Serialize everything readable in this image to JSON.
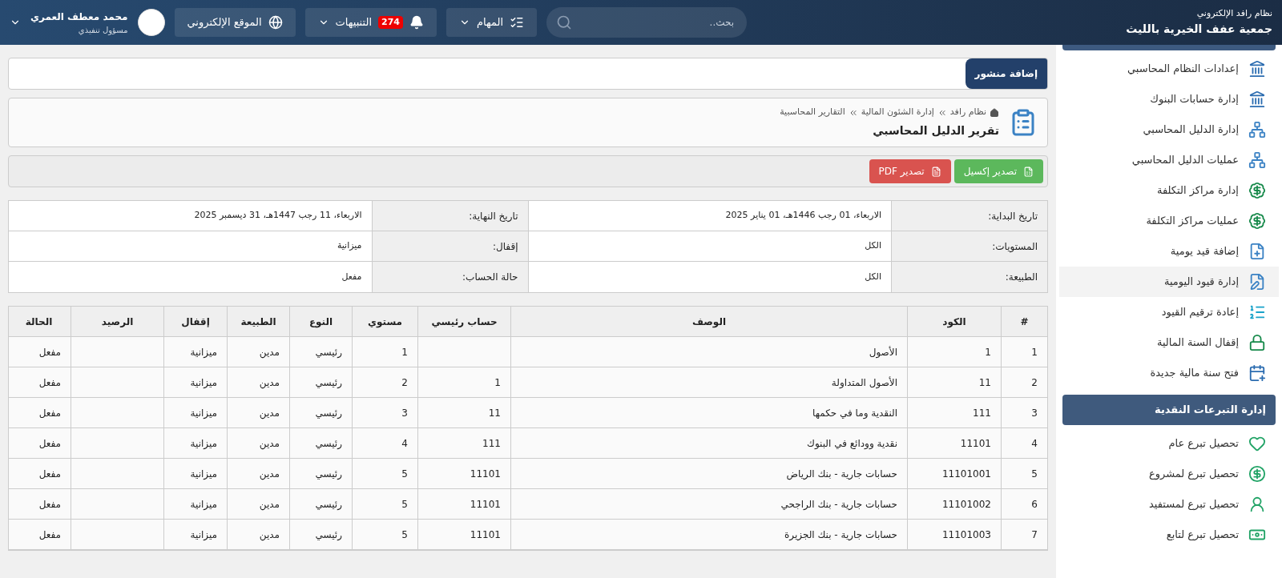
{
  "header": {
    "system": "نظام رافد الإلكتروني",
    "org": "جمعية عفف الخيرية بالليث",
    "search": {
      "placeholder": "بحث.."
    },
    "tasks": "المهام",
    "alerts": {
      "label": "التنبيهات",
      "count": "274"
    },
    "website": "الموقع الإلكتروني",
    "user": {
      "name": "محمد معطف العمري",
      "role": "مسؤول تنفيذي"
    }
  },
  "sidebar": {
    "items": [
      {
        "label": "إعدادات النظام المحاسبي",
        "selected": false
      },
      {
        "label": "إدارة حسابات البنوك",
        "selected": false
      },
      {
        "label": "إدارة الدليل المحاسبي",
        "selected": false
      },
      {
        "label": "عمليات الدليل المحاسبي",
        "selected": false
      },
      {
        "label": "إدارة مراكز التكلفة",
        "selected": false
      },
      {
        "label": "عمليات مراكز التكلفة",
        "selected": false
      },
      {
        "label": "إضافة قيد يومية",
        "selected": false
      },
      {
        "label": "إدارة قيود اليومية",
        "selected": true
      },
      {
        "label": "إعادة ترقيم القيود",
        "selected": false
      },
      {
        "label": "إقفال السنة المالية",
        "selected": false
      },
      {
        "label": "فتح سنة مالية جديدة",
        "selected": false
      }
    ],
    "section": "إدارة التبرعات النقدية",
    "section_items": [
      {
        "label": "تحصيل تبرع عام",
        "selected": false
      },
      {
        "label": "تحصيل تبرع لمشروع",
        "selected": false
      },
      {
        "label": "تحصيل تبرع لمستفيد",
        "selected": false
      },
      {
        "label": "تحصيل تبرع لتابع",
        "selected": false
      }
    ]
  },
  "post_bar": {
    "button": "إضافة منشور"
  },
  "page": {
    "breadcrumb": [
      "نظام رافد",
      "إدارة الشئون المالية",
      "التقارير المحاسبية"
    ],
    "title": "تقرير الدليل المحاسبي"
  },
  "exports": [
    {
      "label": "تصدير إكسيل",
      "kind": "excel"
    },
    {
      "label": "تصدير PDF",
      "kind": "pdf"
    }
  ],
  "filters": [
    [
      {
        "label": "تاريخ البداية:",
        "value": "الاربعاء، 01 رجب 1446هـ، 01 يناير 2025"
      },
      {
        "label": "تاريخ النهاية:",
        "value": "الاربعاء، 11 رجب 1447هـ، 31 ديسمبر 2025"
      }
    ],
    [
      {
        "label": "المستويات:",
        "value": "الكل"
      },
      {
        "label": "إقفال:",
        "value": "ميزانية"
      }
    ],
    [
      {
        "label": "الطبيعة:",
        "value": "الكل"
      },
      {
        "label": "حالة الحساب:",
        "value": "مفعل"
      }
    ]
  ],
  "table": {
    "columns": [
      "#",
      "الكود",
      "الوصف",
      "حساب رئيسي",
      "مستوي",
      "النوع",
      "الطبيعة",
      "إقفال",
      "الرصيد",
      "الحالة"
    ],
    "rows": [
      {
        "n": "1",
        "code": "1",
        "description": "الأصول",
        "level": "1",
        "type": "رئيسي",
        "nature": "مدين",
        "closing": "ميزانية",
        "status": "مفعل"
      },
      {
        "n": "2",
        "code": "11",
        "description": "الأصول المتداولة",
        "parent": "1",
        "level": "2",
        "type": "رئيسي",
        "nature": "مدين",
        "closing": "ميزانية",
        "status": "مفعل"
      },
      {
        "n": "3",
        "code": "111",
        "description": "النقدية وما في حكمها",
        "parent": "11",
        "level": "3",
        "type": "رئيسي",
        "nature": "مدين",
        "closing": "ميزانية",
        "status": "مفعل"
      },
      {
        "n": "4",
        "code": "11101",
        "description": "نقدية وودائع في البنوك",
        "parent": "111",
        "level": "4",
        "type": "رئيسي",
        "nature": "مدين",
        "closing": "ميزانية",
        "status": "مفعل"
      },
      {
        "n": "5",
        "code": "11101001",
        "description": "حسابات جارية - بنك الرياض",
        "parent": "11101",
        "level": "5",
        "type": "رئيسي",
        "nature": "مدين",
        "closing": "ميزانية",
        "status": "مفعل"
      },
      {
        "n": "6",
        "code": "11101002",
        "description": "حسابات جارية - بنك الراجحي",
        "parent": "11101",
        "level": "5",
        "type": "رئيسي",
        "nature": "مدين",
        "closing": "ميزانية",
        "status": "مفعل"
      },
      {
        "n": "7",
        "code": "11101003",
        "description": "حسابات جارية - بنك الجزيرة",
        "parent": "11101",
        "level": "5",
        "type": "رئيسي",
        "nature": "مدين",
        "closing": "ميزانية",
        "status": "مفعل"
      }
    ]
  }
}
